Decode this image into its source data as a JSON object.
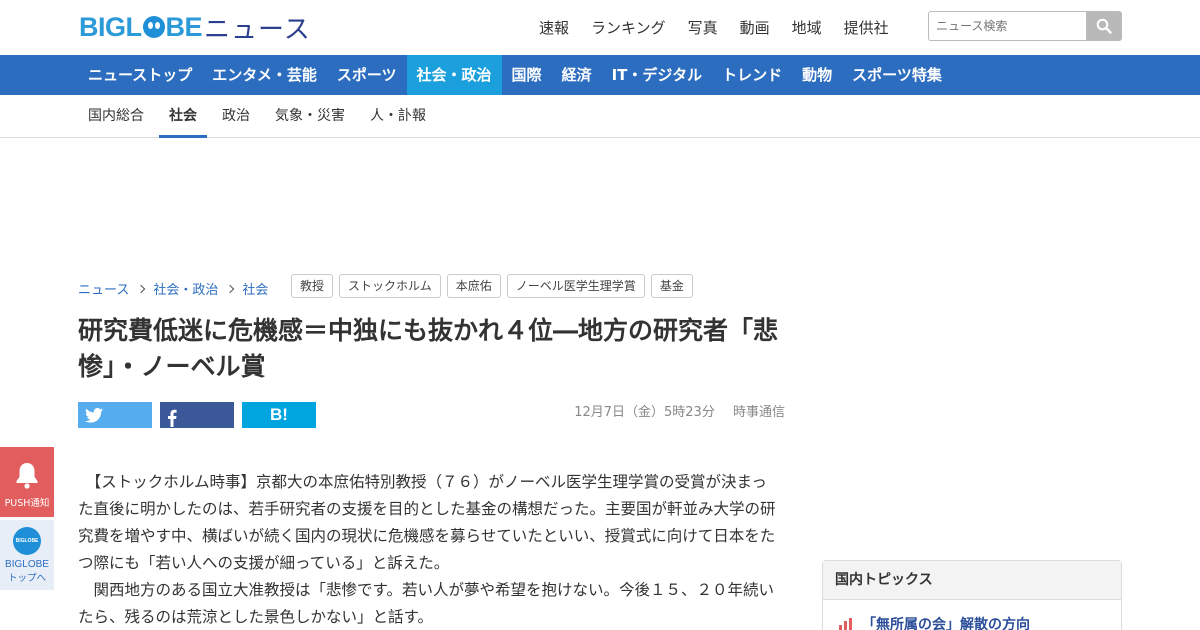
{
  "header": {
    "logo_text": "BIGL",
    "logo_text2": "BE",
    "logo_news": "ニュース",
    "nav": [
      "速報",
      "ランキング",
      "写真",
      "動画",
      "地域",
      "提供社"
    ],
    "search_placeholder": "ニュース検索"
  },
  "mainnav": {
    "items": [
      "ニューストップ",
      "エンタメ・芸能",
      "スポーツ",
      "社会・政治",
      "国際",
      "経済",
      "IT・デジタル",
      "トレンド",
      "動物",
      "スポーツ特集"
    ],
    "active_index": 3
  },
  "subnav": {
    "items": [
      "国内総合",
      "社会",
      "政治",
      "気象・災害",
      "人・訃報"
    ],
    "active_index": 1
  },
  "breadcrumb": [
    "ニュース",
    "社会・政治",
    "社会"
  ],
  "tags": [
    "教授",
    "ストックホルム",
    "本庶佑",
    "ノーベル医学生理学賞",
    "基金"
  ],
  "article": {
    "title": "研究費低迷に危機感＝中独にも抜かれ４位―地方の研究者「悲惨」・ノーベル賞",
    "date": "12月7日（金）5時23分",
    "source": "時事通信",
    "paragraphs": [
      "【ストックホルム時事】京都大の本庶佑特別教授（７６）がノーベル医学生理学賞の受賞が決まった直後に明かしたのは、若手研究者の支援を目的とした基金の構想だった。主要国が軒並み大学の研究費を増やす中、横ばいが続く国内の現状に危機感を募らせていたといい、授賞式に向けて日本をたつ際にも「若い人への支援が細っている」と訴えた。",
      "関西地方のある国立大准教授は「悲惨です。若い人が夢や希望を抱けない。今後１５、２０年続いたら、残るのは荒涼とした景色しかない」と話す。"
    ]
  },
  "share": {
    "hatena_label": "B!"
  },
  "float": {
    "push_label": "PUSH通知",
    "top_ball": "BIGLOBE",
    "top_label1": "BIGLOBE",
    "top_label2": "トップへ"
  },
  "topics": {
    "heading": "国内トピックス",
    "first_item": "「無所属の会」解散の方向"
  },
  "colors": {
    "brand_blue": "#2c6dbf",
    "active_blue": "#1b9fdd",
    "twitter": "#55acee",
    "facebook": "#3b5998",
    "hatena": "#00a4de",
    "push": "#e25d5d"
  }
}
